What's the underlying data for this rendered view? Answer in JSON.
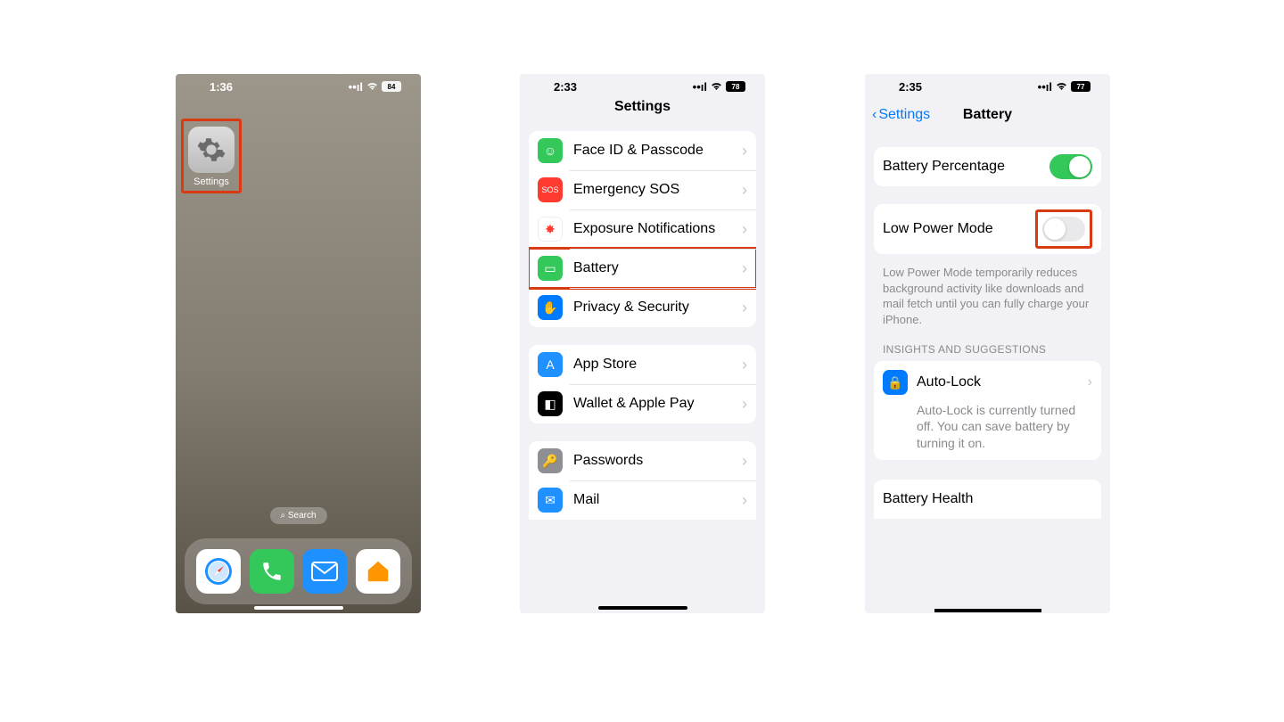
{
  "p1": {
    "status_time": "1:36",
    "battery_pct": "84",
    "app_label": "Settings",
    "search": "Search"
  },
  "p2": {
    "status_time": "2:33",
    "battery_pct": "78",
    "title": "Settings",
    "groupA": [
      {
        "label": "Face ID & Passcode",
        "ic": "bg:#34c759;content:☺"
      },
      {
        "label": "Emergency SOS",
        "ic": "bg:#ff3b30;content:SOS;fs:9"
      },
      {
        "label": "Exposure Notifications",
        "ic": "bg:#fff;content:✸;color:#ff3b30;bd:1",
        "wrap": true
      },
      {
        "label": "Battery",
        "ic": "bg:#34c759;content:▭",
        "hl": true
      },
      {
        "label": "Privacy & Security",
        "ic": "bg:#007aff;content:✋"
      }
    ],
    "groupB": [
      {
        "label": "App Store",
        "ic": "bg:#1e90ff;content:A"
      },
      {
        "label": "Wallet & Apple Pay",
        "ic": "bg:#000;content:◧"
      }
    ],
    "groupC": [
      {
        "label": "Passwords",
        "ic": "bg:#8e8e93;content:🔑"
      },
      {
        "label": "Mail",
        "ic": "bg:#1e90ff;content:✉"
      }
    ]
  },
  "p3": {
    "status_time": "2:35",
    "battery_pct": "77",
    "back": "Settings",
    "title": "Battery",
    "rowA_label": "Battery Percentage",
    "rowA_on": true,
    "rowB_label": "Low Power Mode",
    "rowB_on": false,
    "rowB_hl": true,
    "lpm_desc": "Low Power Mode temporarily reduces background activity like downloads and mail fetch until you can fully charge your iPhone.",
    "section": "INSIGHTS AND SUGGESTIONS",
    "autolock_label": "Auto-Lock",
    "autolock_desc": "Auto-Lock is currently turned off. You can save battery by turning it on.",
    "bhealth": "Battery Health"
  }
}
